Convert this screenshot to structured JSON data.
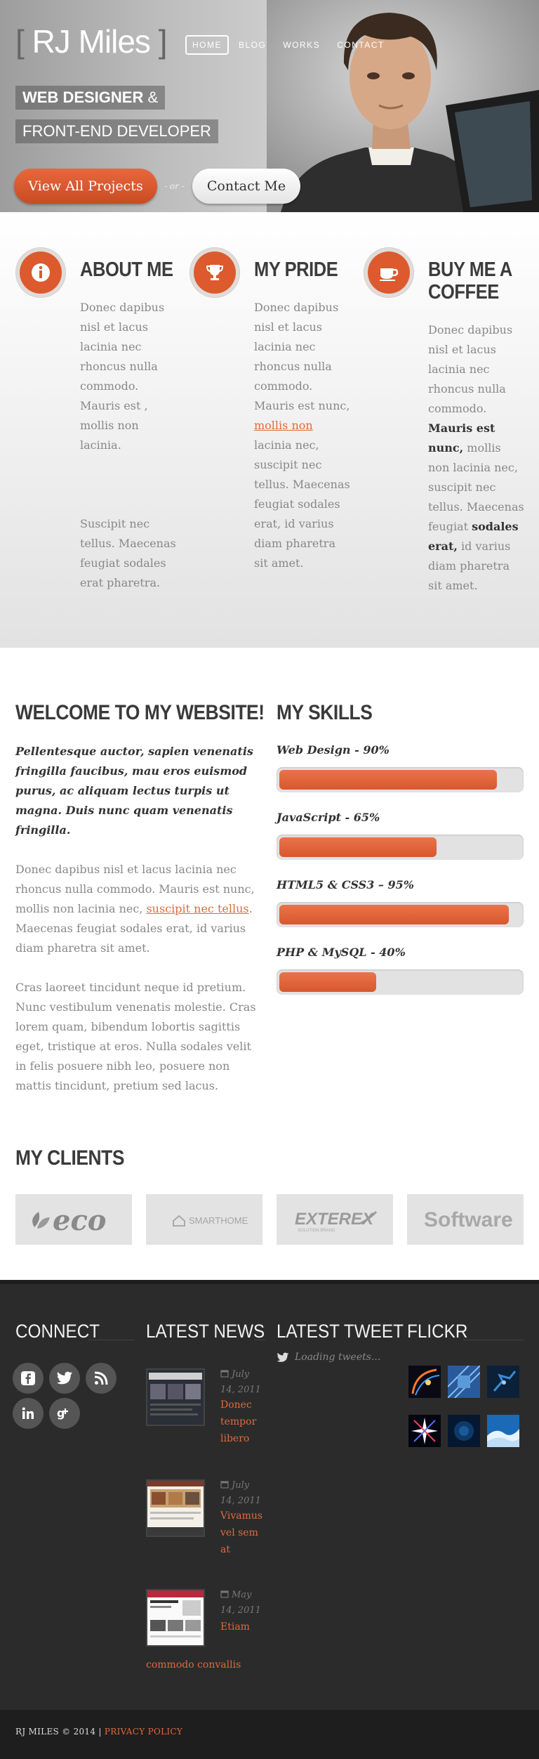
{
  "header": {
    "logo": "RJ Miles",
    "nav": [
      "HOME",
      "BLOG",
      "WORKS",
      "CONTACT"
    ],
    "tagline_1a": "WEB DESIGNER",
    "tagline_1b": " &",
    "tagline_2": "FRONT-END DEVELOPER",
    "cta_primary": "View All Projects",
    "or": "- or -",
    "cta_secondary": "Contact Me"
  },
  "features": [
    {
      "title": "ABOUT ME",
      "p1": "Donec dapibus nisl et lacus lacinia nec rhoncus nulla commodo. Mauris est , mollis non lacinia.",
      "p2": "Suscipit nec tellus. Maecenas feugiat sodales erat pharetra."
    },
    {
      "title": "MY PRIDE",
      "p1a": "Donec dapibus nisl et lacus lacinia nec rhoncus nulla commodo. Mauris est nunc, ",
      "link": "mollis non",
      "p1b": " lacinia nec, suscipit nec tellus. Maecenas feugiat sodales erat, id varius diam pharetra sit amet."
    },
    {
      "title": "BUY ME A COFFEE",
      "p1a": "Donec dapibus nisl et lacus lacinia nec rhoncus nulla commodo. ",
      "bold1": "Mauris est nunc,",
      "p1b": " mollis non lacinia nec, suscipit nec tellus. Maecenas feugiat ",
      "bold2": "sodales erat,",
      "p1c": " id varius diam pharetra sit amet."
    }
  ],
  "welcome": {
    "title": "WELCOME TO MY WEBSITE!",
    "lead": "Pellentesque auctor, sapien venenatis fringilla faucibus, mau eros euismod purus, ac aliquam lectus turpis ut magna. Duis nunc quam venenatis fringilla.",
    "p1a": "Donec dapibus nisl et lacus lacinia nec rhoncus nulla commodo. Mauris est nunc, mollis non lacinia nec, ",
    "p1_link": "suscipit nec tellus",
    "p1b": ". Maecenas feugiat sodales erat, id varius diam pharetra sit amet.",
    "p2": "Cras laoreet tincidunt neque id pretium. Nunc vestibulum venenatis molestie. Cras lorem quam, bibendum lobortis sagittis eget, tristique at eros. Nulla sodales velit in felis posuere nibh leo, posuere non mattis tincidunt, pretium sed lacus."
  },
  "skills": {
    "title": "MY SKILLS",
    "items": [
      {
        "label": "Web Design - 90%",
        "percent": 90
      },
      {
        "label": "JavaScript - 65%",
        "percent": 65
      },
      {
        "label": "HTML5 & CSS3 – 95%",
        "percent": 95
      },
      {
        "label": "PHP & MySQL - 40%",
        "percent": 40
      }
    ]
  },
  "clients": {
    "title": "MY CLIENTS",
    "logos": [
      "eco",
      "SMARTHOME",
      "EXTEREX",
      "Software"
    ],
    "exterex_sub": "SOLUTION BRAND"
  },
  "footer": {
    "connect_title": "CONNECT",
    "news_title": "LATEST NEWS",
    "tweet_title": "LATEST TWEET",
    "flickr_title": "FLICKR",
    "news": [
      {
        "date": "July 14, 2011",
        "title": "Donec tempor libero"
      },
      {
        "date": "July 14, 2011",
        "title": "Vivamus vel sem at"
      },
      {
        "date": "May 14, 2011",
        "title_a": "Etiam",
        "title_b": "commodo convallis"
      }
    ],
    "tweet": "Loading tweets...",
    "copyright": "RJ MILES © 2014 |",
    "privacy": "PRIVACY POLICY"
  },
  "colors": {
    "accent": "#dc5a2e",
    "dark": "#2b2b2b",
    "heading": "#3c3c3c"
  },
  "icons": [
    "info-icon",
    "trophy-icon",
    "coffee-cup-icon",
    "facebook-icon",
    "twitter-icon",
    "rss-icon",
    "linkedin-icon",
    "google-plus-icon",
    "calendar-icon",
    "twitter-bird-icon"
  ]
}
